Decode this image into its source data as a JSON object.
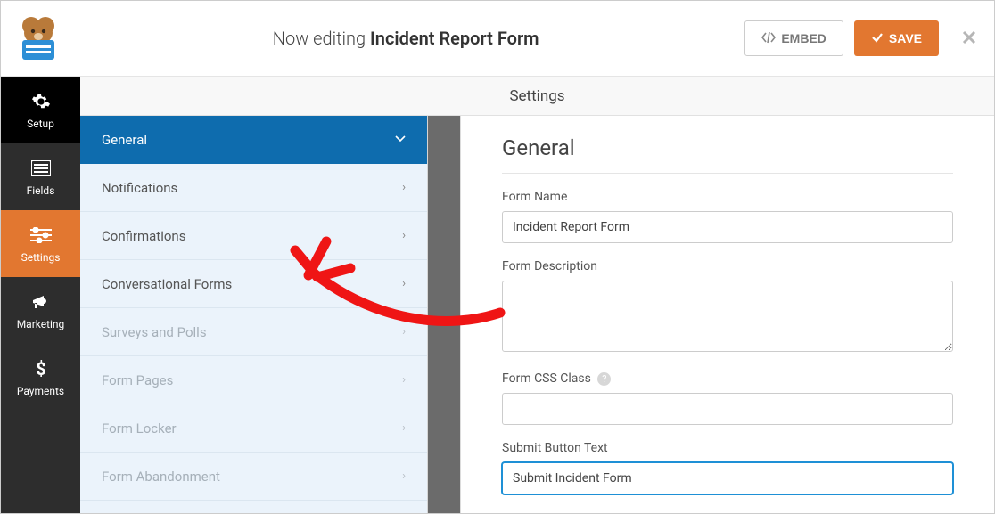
{
  "header": {
    "editing_prefix": "Now editing",
    "form_title": "Incident Report Form",
    "embed_label": "EMBED",
    "save_label": "SAVE"
  },
  "rail": {
    "setup": "Setup",
    "fields": "Fields",
    "settings": "Settings",
    "marketing": "Marketing",
    "payments": "Payments"
  },
  "panel_title": "Settings",
  "settings_nav": {
    "general": "General",
    "notifications": "Notifications",
    "confirmations": "Confirmations",
    "conversational": "Conversational Forms",
    "surveys": "Surveys and Polls",
    "pages": "Form Pages",
    "locker": "Form Locker",
    "abandonment": "Form Abandonment"
  },
  "form": {
    "heading": "General",
    "name_label": "Form Name",
    "name_value": "Incident Report Form",
    "desc_label": "Form Description",
    "desc_value": "",
    "css_label": "Form CSS Class",
    "css_value": "",
    "submit_label": "Submit Button Text",
    "submit_value": "Submit Incident Form"
  }
}
